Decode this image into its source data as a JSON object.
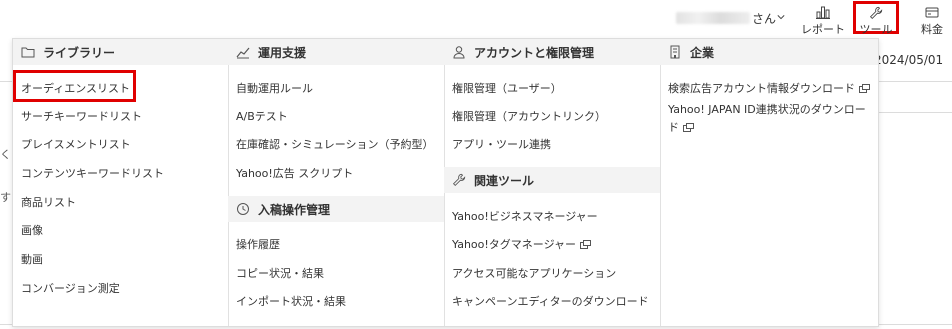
{
  "header": {
    "user_suffix": "さん",
    "report_label": "レポート",
    "tool_label": "ツール",
    "fee_label": "料金"
  },
  "background": {
    "date_text": "2024/05/01",
    "side_chars": [
      "く",
      "す"
    ]
  },
  "menu": {
    "library": {
      "title": "ライブラリー",
      "icon": "folder-icon",
      "items": [
        "オーディエンスリスト",
        "サーチキーワードリスト",
        "プレイスメントリスト",
        "コンテンツキーワードリスト",
        "商品リスト",
        "画像",
        "動画",
        "コンバージョン測定"
      ]
    },
    "operation_support": {
      "title": "運用支援",
      "icon": "line-chart-icon",
      "items": [
        "自動運用ルール",
        "A/Bテスト",
        "在庫確認・シミュレーション（予約型）",
        "Yahoo!広告 スクリプト"
      ]
    },
    "submission": {
      "title": "入稿操作管理",
      "icon": "history-icon",
      "items": [
        "操作履歴",
        "コピー状況・結果",
        "インポート状況・結果"
      ]
    },
    "account": {
      "title": "アカウントと権限管理",
      "icon": "person-icon",
      "items": [
        "権限管理（ユーザー）",
        "権限管理（アカウントリンク）",
        "アプリ・ツール連携"
      ]
    },
    "related_tools": {
      "title": "関連ツール",
      "icon": "wrench-icon",
      "items": [
        "Yahoo!ビジネスマネージャー",
        "Yahoo!タグマネージャー",
        "アクセス可能なアプリケーション",
        "キャンペーンエディターのダウンロード"
      ]
    },
    "company": {
      "title": "企業",
      "icon": "building-icon",
      "items": [
        "検索広告アカウント情報ダウンロード",
        "Yahoo! JAPAN ID連携状況のダウンロード"
      ]
    }
  },
  "colors": {
    "highlight": "#e00000",
    "section_bg": "#f3f3f3",
    "border": "#dddddd"
  }
}
